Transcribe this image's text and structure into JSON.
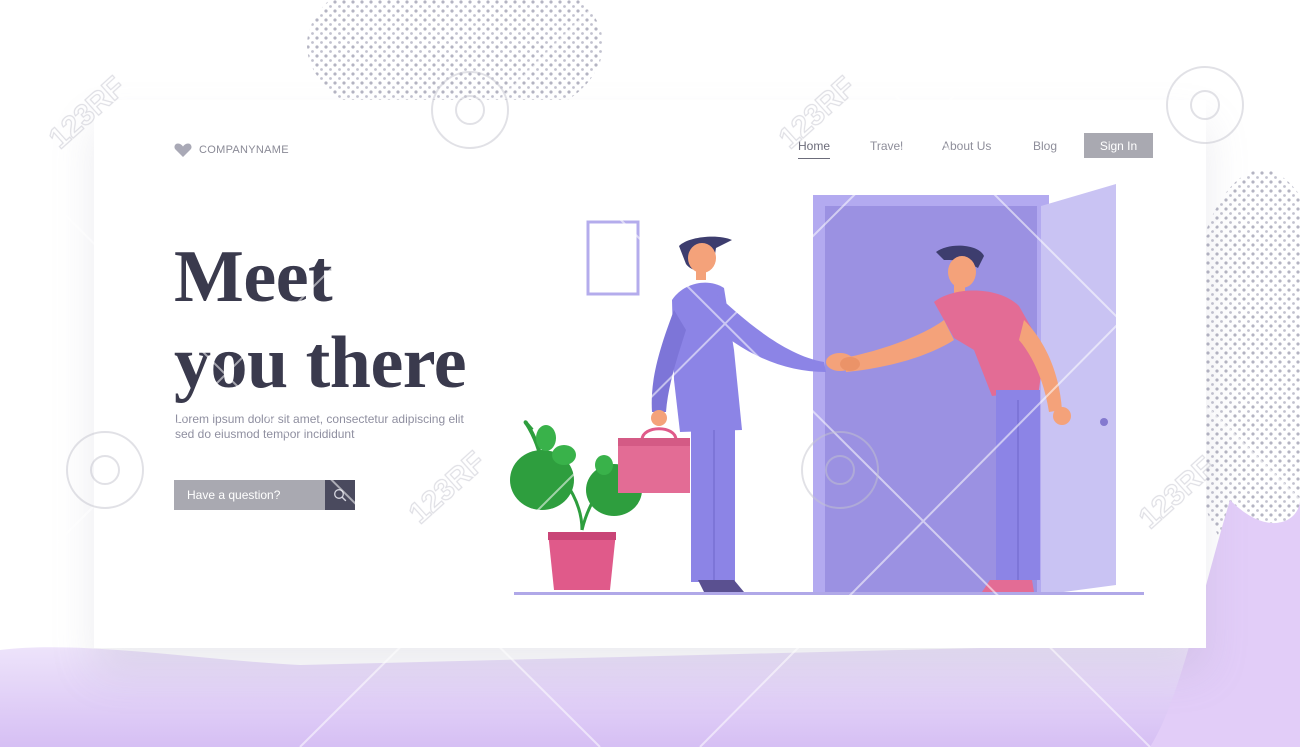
{
  "brand": {
    "name": "COMPANYNAME",
    "logo_icon": "heart-icon"
  },
  "nav": {
    "items": [
      {
        "label": "Home",
        "active": true
      },
      {
        "label": "Travel",
        "active": false
      },
      {
        "label": "About Us",
        "active": false
      },
      {
        "label": "Blog",
        "active": false
      }
    ],
    "signin_label": "Sign In"
  },
  "hero": {
    "title_line1": "Meet",
    "title_line2": "you there",
    "body_line1": "Lorem ipsum dolor sit amet, consectetur adipiscing elit",
    "body_line2": "sed do eiusmod tempor incididunt"
  },
  "search": {
    "placeholder": "Have a question?",
    "icon": "search-icon"
  },
  "watermark": {
    "text": "123RF",
    "icon": "camera-icon"
  },
  "colors": {
    "headline": "#3a3a4d",
    "accent_purple": "#8f86d8",
    "door_purple": "#a59ae0",
    "suit_purple": "#8c84e6",
    "shirt_pink": "#e36c95",
    "plant_green": "#2e9e3e",
    "pot_pink": "#e05a8a",
    "button_gray": "#a9a9b1",
    "search_button": "#4a4a5e"
  }
}
